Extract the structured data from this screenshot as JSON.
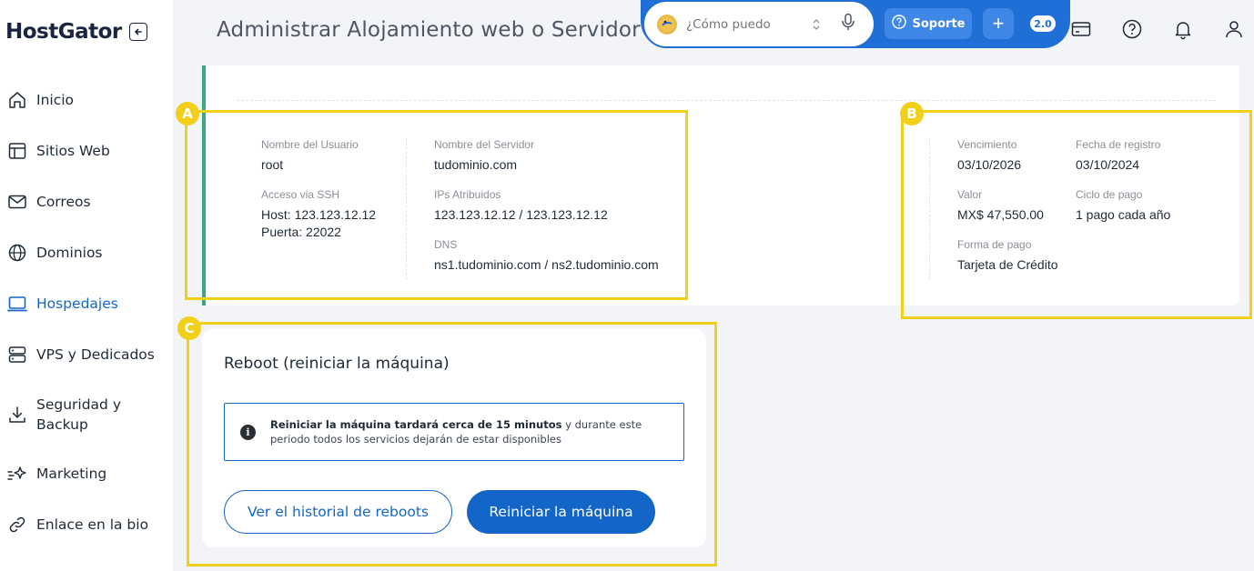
{
  "brand": {
    "name": "HostGator"
  },
  "header": {
    "title": "Administrar Alojamiento web o Servidor",
    "assistant_placeholder": "¿Cómo puedo",
    "support_label": "Soporte",
    "plus_label": "+",
    "version_badge": "2.0",
    "icons": [
      "billing-card-icon",
      "help-icon",
      "bell-icon",
      "user-icon"
    ]
  },
  "sidebar": {
    "items": [
      {
        "label": "Inicio",
        "icon": "home-icon"
      },
      {
        "label": "Sitios Web",
        "icon": "layout-icon"
      },
      {
        "label": "Correos",
        "icon": "mail-icon"
      },
      {
        "label": "Dominios",
        "icon": "globe-icon"
      },
      {
        "label": "Hospedajes",
        "icon": "hosting-icon",
        "active": true
      },
      {
        "label": "VPS y Dedicados",
        "icon": "server-icon"
      },
      {
        "label": "Seguridad y Backup",
        "icon": "download-icon"
      },
      {
        "label": "Marketing",
        "icon": "sparkle-icon"
      },
      {
        "label": "Enlace en la bio",
        "icon": "link-icon"
      }
    ]
  },
  "server_info": {
    "username": {
      "label": "Nombre del Usuario",
      "value": "root"
    },
    "ssh": {
      "label": "Acceso via SSH",
      "host": "Host: 123.123.12.12",
      "port": "Puerta: 22022"
    },
    "server_name": {
      "label": "Nombre del Servidor",
      "value": "tudominio.com"
    },
    "ips": {
      "label": "IPs Atribuidos",
      "value": "123.123.12.12 / 123.123.12.12"
    },
    "dns": {
      "label": "DNS",
      "value": "ns1.tudominio.com / ns2.tudominio.com"
    }
  },
  "billing": {
    "expiration": {
      "label": "Vencimiento",
      "value": "03/10/2026"
    },
    "registration": {
      "label": "Fecha de registro",
      "value": "03/10/2024"
    },
    "price": {
      "label": "Valor",
      "value": "MX$ 47,550.00"
    },
    "cycle": {
      "label": "Ciclo de pago",
      "value": "1 pago cada año"
    },
    "payment": {
      "label": "Forma de pago",
      "value": "Tarjeta de Crédito"
    }
  },
  "reboot": {
    "title": "Reboot (reiniciar la máquina)",
    "alert_bold": "Reiniciar la máquina tardará cerca de 15 minutos",
    "alert_rest": " y durante este periodo todos los servicios dejarán de estar disponibles",
    "history_button": "Ver el historial de reboots",
    "reboot_button": "Reiniciar la máquina"
  },
  "annotations": {
    "a": "A",
    "b": "B",
    "c": "C"
  },
  "colors": {
    "accent": "#1366c8",
    "highlight": "#f1cf1a",
    "status_bar": "#39a87c"
  }
}
